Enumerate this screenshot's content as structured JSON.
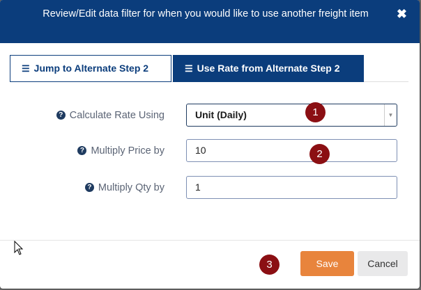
{
  "header": {
    "title": "Review/Edit data filter for when you would like to use another freight item",
    "close_icon": "close-icon"
  },
  "tabs": [
    {
      "label": "Jump to Alternate Step 2",
      "icon": "list-icon"
    },
    {
      "label": "Use Rate from Alternate Step 2",
      "icon": "list-icon"
    }
  ],
  "form": {
    "calculate_rate_label": "Calculate Rate Using",
    "calculate_rate_value": "Unit (Daily)",
    "multiply_price_label": "Multiply Price by",
    "multiply_price_value": "10",
    "multiply_qty_label": "Multiply Qty by",
    "multiply_qty_value": "1"
  },
  "badges": [
    "1",
    "2",
    "3"
  ],
  "footer": {
    "save_label": "Save",
    "cancel_label": "Cancel"
  },
  "colors": {
    "primary": "#0b3d7c",
    "save": "#e8843c",
    "badge": "#8b0f13"
  }
}
